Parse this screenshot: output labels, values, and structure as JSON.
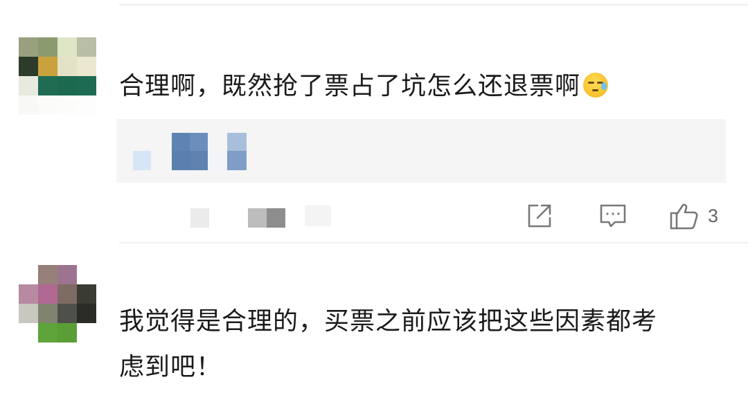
{
  "comments": [
    {
      "username": "",
      "text": "合理啊，既然抢了票占了坑怎么还退票啊",
      "emoji": "sweat-smile-emoji",
      "reply_preview": "",
      "meta": "",
      "actions": {
        "share_icon": "share-icon",
        "comment_icon": "comment-icon",
        "like_icon": "thumbs-up-icon",
        "like_count": "3"
      }
    },
    {
      "username": "",
      "text_line1": "我觉得是合理的，买票之前应该把这些因素都考",
      "text_line2": "虑到吧！"
    }
  ],
  "colors": {
    "text": "#1a1a1a",
    "icon": "#777777",
    "reply_bg": "#f5f5f5",
    "divider": "#efefef"
  }
}
